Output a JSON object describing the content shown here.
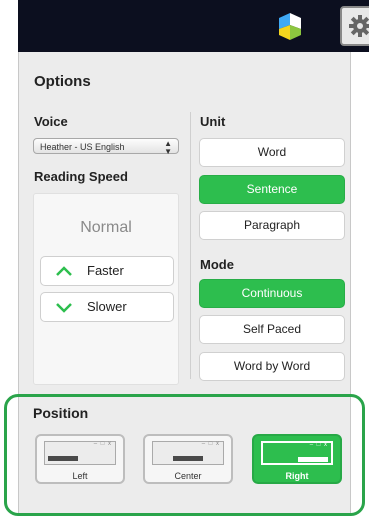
{
  "header": {
    "logo_icon": "app-logo-icon",
    "settings_icon": "gear-icon"
  },
  "options": {
    "title": "Options",
    "voice": {
      "label": "Voice",
      "selected": "Heather - US English",
      "arrows": "▲▼"
    },
    "reading_speed": {
      "label": "Reading Speed",
      "value": "Normal",
      "faster_label": "Faster",
      "slower_label": "Slower"
    },
    "unit": {
      "label": "Unit",
      "options": [
        "Word",
        "Sentence",
        "Paragraph"
      ],
      "selected": "Sentence"
    },
    "mode": {
      "label": "Mode",
      "options": [
        "Continuous",
        "Self Paced",
        "Word by Word"
      ],
      "selected": "Continuous"
    },
    "position": {
      "label": "Position",
      "options": [
        "Left",
        "Center",
        "Right"
      ],
      "selected": "Right",
      "window_controls": "– □ x"
    }
  },
  "colors": {
    "accent_green": "#2dbe4e",
    "highlight_frame": "#2aa44a",
    "topbar": "#0c0f1f"
  }
}
